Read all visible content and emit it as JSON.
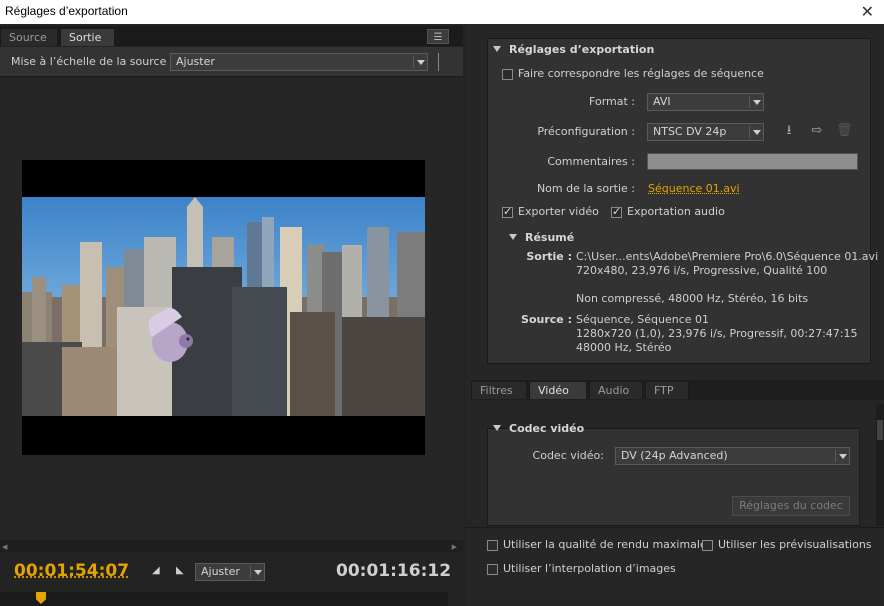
{
  "window": {
    "title": "Réglages d’exportation",
    "close": "✕"
  },
  "left": {
    "tabs": [
      {
        "label": "Source"
      },
      {
        "label": "Sortie"
      }
    ],
    "scale_label": "Mise à l’échelle de la source :",
    "scale_value": "Ajuster",
    "timecode_in": "00:01:54:07",
    "timecode_out": "00:01:16:12",
    "zoom_value": "Ajuster"
  },
  "export": {
    "header": "Réglages d’exportation",
    "match_sequence": "Faire correspondre les réglages de séquence",
    "format_label": "Format :",
    "format_value": "AVI",
    "preset_label": "Préconfiguration :",
    "preset_value": "NTSC DV 24p",
    "comments_label": "Commentaires :",
    "comments_value": "",
    "output_name_label": "Nom de la sortie :",
    "output_name_value": "Séquence 01.avi",
    "export_video": "Exporter vidéo",
    "export_audio": "Exportation audio",
    "summary_header": "Résumé",
    "output_key": "Sortie :",
    "output_lines": [
      "C:\\User...ents\\Adobe\\Premiere Pro\\6.0\\Séquence 01.avi",
      "720x480, 23,976 i/s, Progressive, Qualité  100",
      "",
      "Non compressé, 48000 Hz, Stéréo, 16 bits"
    ],
    "source_key": "Source :",
    "source_lines": [
      "Séquence, Séquence 01",
      "1280x720 (1,0), 23,976  i/s, Progressif, 00:27:47:15",
      "48000 Hz, Stéréo"
    ]
  },
  "lower_tabs": [
    {
      "label": "Filtres"
    },
    {
      "label": "Vidéo"
    },
    {
      "label": "Audio"
    },
    {
      "label": "FTP"
    }
  ],
  "codec": {
    "header": "Codec vidéo",
    "label": "Codec vidéo:",
    "value": "DV (24p Advanced)",
    "settings_button": "Réglages du codec"
  },
  "options": {
    "max_render": "Utiliser la qualité de rendu maximale",
    "previews": "Utiliser les prévisualisations",
    "interpolation": "Utiliser l’interpolation d’images"
  },
  "colors": {
    "accent": "#e4a300",
    "panel": "#323232",
    "background": "#232323"
  }
}
